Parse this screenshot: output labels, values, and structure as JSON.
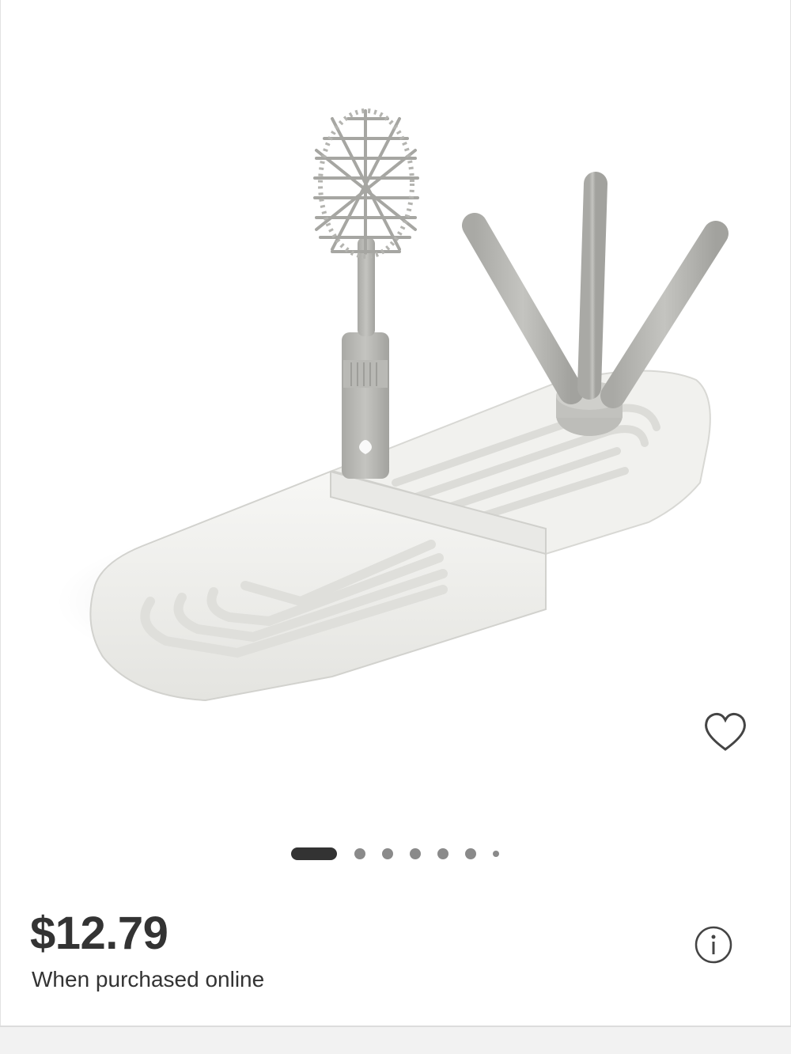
{
  "product": {
    "image_description_icon": "product-photo",
    "price": "$12.79",
    "price_note": "When purchased online"
  },
  "carousel": {
    "total_dots": 7,
    "active_index": 0
  },
  "icons": {
    "favorite": "heart-outline-icon",
    "info": "info-circle-icon"
  },
  "colors": {
    "text": "#333333",
    "dot_active": "#333333",
    "dot_inactive": "#8a8a8a",
    "product_gray": "#b5b5b1",
    "product_white": "#efefec"
  }
}
